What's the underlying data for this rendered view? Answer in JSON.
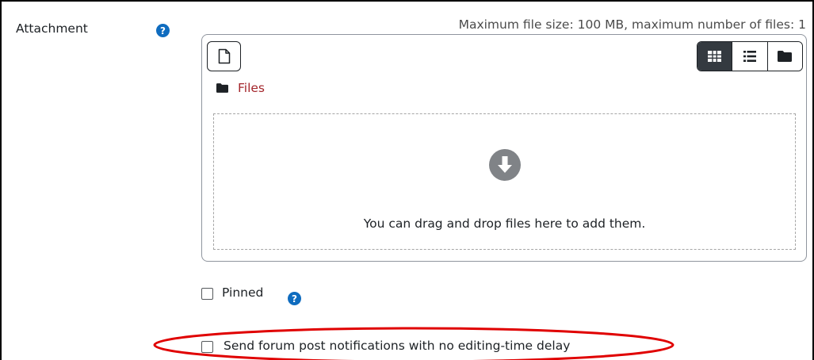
{
  "attachment": {
    "label": "Attachment",
    "help_icon": "question-circle-icon",
    "max_info": "Maximum file size: 100 MB, maximum number of files: 1"
  },
  "filepicker": {
    "add_file_icon": "file-icon",
    "views": [
      {
        "name": "grid-view-icon",
        "active": true
      },
      {
        "name": "list-view-icon",
        "active": false
      },
      {
        "name": "tree-view-icon",
        "active": false
      }
    ],
    "folder_icon": "folder-icon",
    "files_link": "Files",
    "drop_icon": "arrow-down-circle-icon",
    "drop_text": "You can drag and drop files here to add them."
  },
  "options": {
    "pinned_label": "Pinned",
    "pinned_checked": false,
    "send_label": "Send forum post notifications with no editing-time delay",
    "send_checked": false
  },
  "colors": {
    "help_blue": "#0f6cbf",
    "link_red": "#a4262c",
    "highlight_red": "#e00000",
    "active_view_bg": "#343a40"
  }
}
